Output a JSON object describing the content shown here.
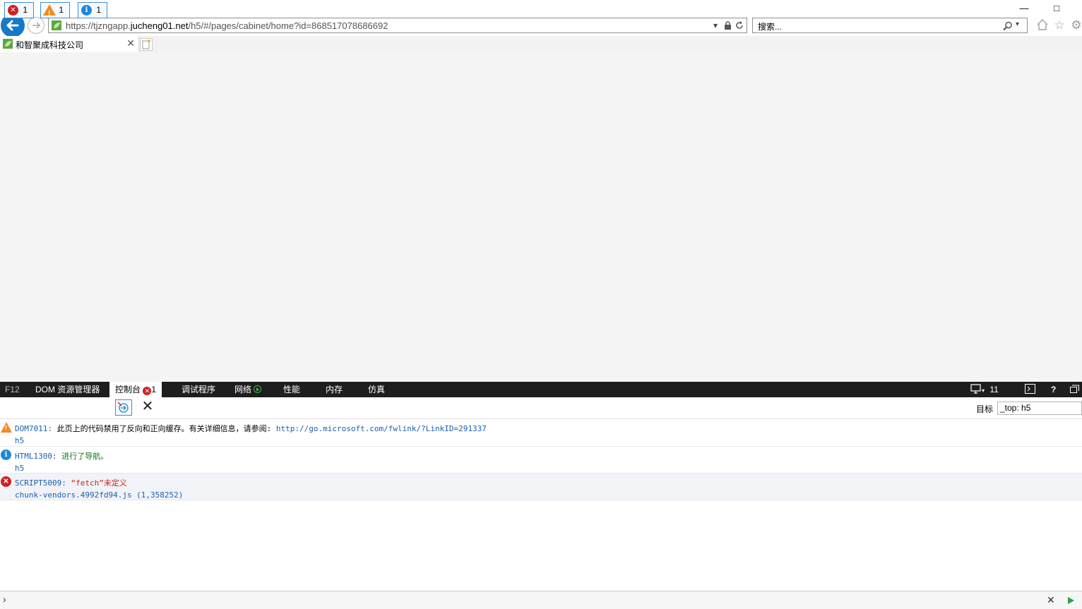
{
  "browser": {
    "url_scheme": "https://tjzngapp.",
    "url_host": "jucheng01.net",
    "url_path": "/h5/#/pages/cabinet/home?id=868517078686692",
    "search_placeholder": "搜索...",
    "tab_title": "和智聚成科技公司",
    "icons": [
      "back-icon",
      "forward-icon",
      "lock-icon",
      "refresh-icon",
      "search-icon",
      "home-icon",
      "favorites-star-icon",
      "settings-gear-icon"
    ]
  },
  "devtools": {
    "tabs": {
      "f12": "F12",
      "dom": "DOM 资源管理器",
      "console": "控制台",
      "console_errors": "1",
      "debugger": "调试程序",
      "network": "网络",
      "performance": "性能",
      "memory": "内存",
      "emulation": "仿真"
    },
    "doc_mode": "11",
    "filters": {
      "errors": "1",
      "warnings": "1",
      "info": "1"
    },
    "target_label": "目标",
    "target_value": "_top: h5",
    "messages": [
      {
        "type": "warning",
        "code": "DOM7011:",
        "text": "此页上的代码禁用了反向和正向缓存。有关详细信息，请参阅:",
        "link": "http://go.microsoft.com/fwlink/?LinkID=291337",
        "source": "h5"
      },
      {
        "type": "info",
        "code": "HTML1300:",
        "text": "进行了导航。",
        "source": "h5"
      },
      {
        "type": "error",
        "code": "SCRIPT5009:",
        "text": "“fetch”未定义",
        "source": "chunk-vendors.4992fd94.js (1,358252)"
      }
    ],
    "colors": {
      "toolbar_bg": "#1e1e1e",
      "error": "#d21f1f",
      "warning": "#f08a24",
      "info": "#1e88d6",
      "link": "#1a5fb4"
    }
  }
}
